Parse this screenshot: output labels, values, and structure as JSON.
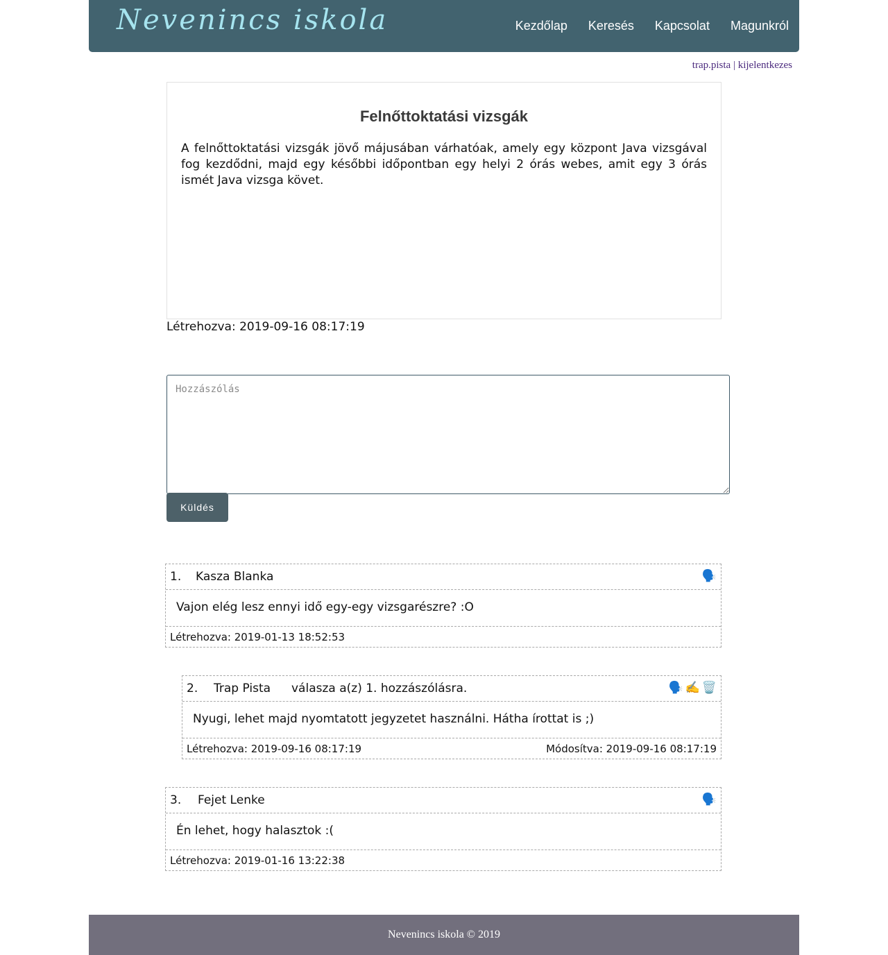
{
  "header": {
    "logo": "Nevenincs iskola",
    "nav": [
      "Kezdőlap",
      "Keresés",
      "Kapcsolat",
      "Magunkról"
    ]
  },
  "userbar": {
    "username": "trap.pista",
    "separator": "|",
    "logout": "kijelentkezes"
  },
  "article": {
    "title": "Felnőttoktatási vizsgák",
    "body": "A felnőttoktatási vizsgák jövő májusában várhatóak, amely egy központ Java vizsgával fog kezdődni, majd egy későbbi időpontban egy helyi 2 órás webes, amit egy 3 órás ismét Java vizsga követ.",
    "created": "Létrehozva: 2019-09-16 08:17:19"
  },
  "comment_form": {
    "placeholder": "Hozzászólás",
    "submit_label": "Küldés"
  },
  "comments": [
    {
      "number": "1.",
      "author": "Kasza Blanka",
      "reply_note": "",
      "text": "Vajon elég lesz ennyi idő egy-egy vizsgarészre? :O",
      "created": "Létrehozva: 2019-01-13 18:52:53",
      "modified": "",
      "icons": [
        "reply-icon"
      ]
    },
    {
      "number": "2.",
      "author": "Trap Pista",
      "reply_note": "válasza a(z) 1. hozzászólásra.",
      "text": "Nyugi, lehet majd nyomtatott jegyzetet használni. Hátha írottat is ;)",
      "created": "Létrehozva: 2019-09-16 08:17:19",
      "modified": "Módosítva: 2019-09-16 08:17:19",
      "icons": [
        "reply-icon",
        "edit-icon",
        "delete-icon"
      ]
    },
    {
      "number": "3.",
      "author": "Fejet Lenke",
      "reply_note": "",
      "text": "Én lehet, hogy halasztok :(",
      "created": "Létrehozva: 2019-01-16 13:22:38",
      "modified": "",
      "icons": [
        "reply-icon"
      ]
    }
  ],
  "footer": {
    "text": "Nevenincs iskola © 2019"
  }
}
